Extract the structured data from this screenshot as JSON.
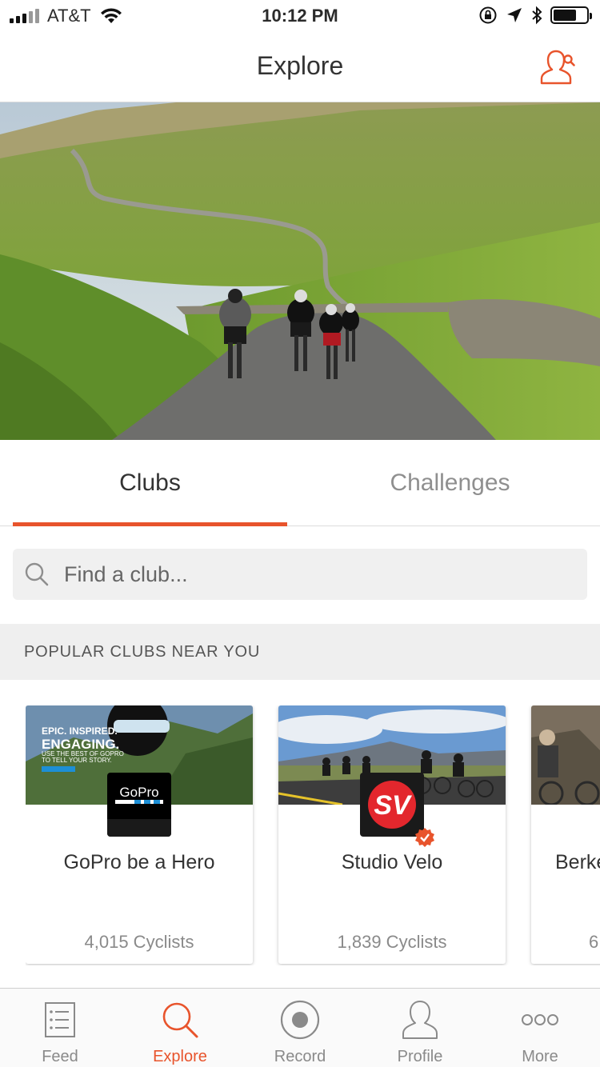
{
  "status_bar": {
    "carrier": "AT&T",
    "time": "10:12 PM"
  },
  "navbar": {
    "title": "Explore",
    "find_friends_icon": "person-search-icon"
  },
  "tabs": [
    {
      "label": "Clubs",
      "selected": true
    },
    {
      "label": "Challenges",
      "selected": false
    }
  ],
  "search": {
    "placeholder": "Find a club..."
  },
  "section": {
    "title": "POPULAR CLUBS NEAR YOU"
  },
  "clubs": [
    {
      "name": "GoPro be a Hero",
      "members": "4,015 Cyclists",
      "cover_text": [
        "EPIC. INSPIRED.",
        "ENGAGING.",
        "USE THE BEST OF GOPRO",
        "TO TELL YOUR STORY."
      ],
      "logo_text": "GoPro"
    },
    {
      "name": "Studio Velo",
      "members": "1,839 Cyclists",
      "logo_text": "SV",
      "verified": true
    },
    {
      "name": "Berke",
      "members": "6"
    }
  ],
  "tab_bar": [
    {
      "label": "Feed",
      "icon": "feed-icon",
      "active": false
    },
    {
      "label": "Explore",
      "icon": "explore-search-icon",
      "active": true
    },
    {
      "label": "Record",
      "icon": "record-icon",
      "active": false
    },
    {
      "label": "Profile",
      "icon": "profile-icon",
      "active": false
    },
    {
      "label": "More",
      "icon": "more-icon",
      "active": false
    }
  ],
  "colors": {
    "accent": "#e8542c",
    "inactive": "#8a8a8a"
  }
}
